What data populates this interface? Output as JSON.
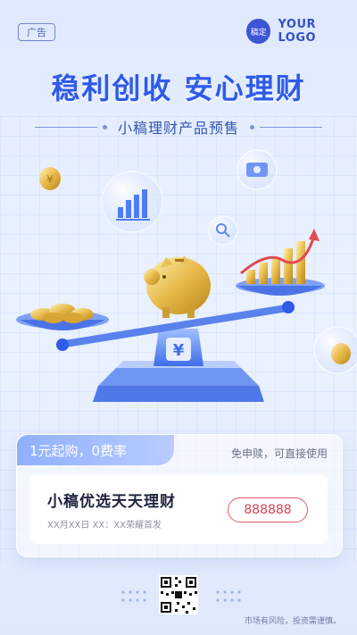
{
  "header": {
    "ad_tag": "广告",
    "logo_badge": "稿定",
    "logo_text": "YOUR LOGO"
  },
  "hero": {
    "headline": "稳利创收  安心理财",
    "subline": "小稿理财产品预售"
  },
  "card": {
    "tab_label": "1元起购，0费率",
    "note": "免申赎，可直接使用",
    "product_title": "小稿优选天天理财",
    "product_date": "XX月XX日 XX：XX荣耀首发",
    "product_code": "888888"
  },
  "footer": {
    "risk_warning": "市场有风险，投资需谨慎。"
  },
  "colors": {
    "primary_blue": "#2f5bea",
    "accent_red": "#e05b66",
    "gold": "#e7b94a"
  },
  "icons": [
    "coin-icon",
    "bar-chart-icon",
    "search-icon",
    "money-icon",
    "yen-icon",
    "piggy-bank",
    "qr-code"
  ]
}
